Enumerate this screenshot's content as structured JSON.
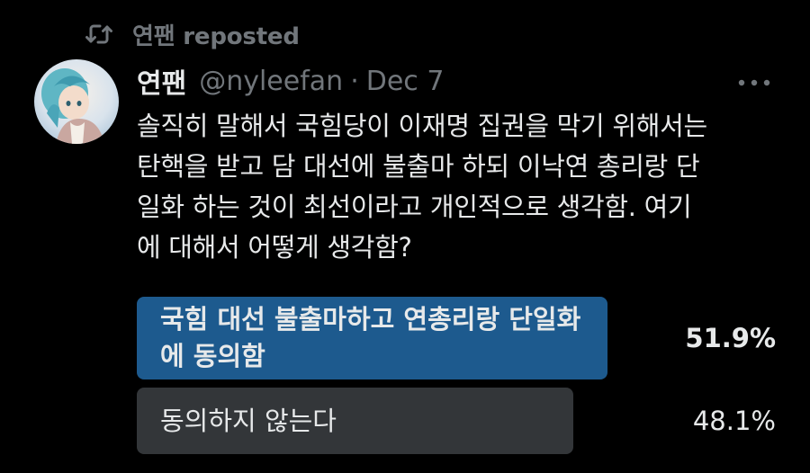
{
  "repost": {
    "icon": "repost-icon",
    "text": "연팬 reposted"
  },
  "author": {
    "display_name": "연팬",
    "handle": "@nyleefan",
    "separator": "·",
    "date": "Dec 7"
  },
  "tweet": {
    "text": "솔직히 말해서 국힘당이 이재명 집권을 막기 위해서는\n탄핵을 받고 담 대선에 불출마 하되 이낙연 총리랑 단\n일화 하는 것이 최선이라고 개인적으로 생각함. 여기\n에 대해서 어떻게 생각함?"
  },
  "poll": {
    "options": [
      {
        "label": "국힘 대선 불출마하고 연총리랑 단일화\n에 동의함",
        "percent": "51.9%",
        "fraction": 0.519,
        "winner": true
      },
      {
        "label": "동의하지 않는다",
        "percent": "48.1%",
        "fraction": 0.481,
        "winner": false
      }
    ]
  },
  "colors": {
    "background": "#000000",
    "text": "#e7e9ea",
    "muted": "#71767b",
    "winner_bar": "#1d5a8e",
    "other_bar": "#333639"
  }
}
